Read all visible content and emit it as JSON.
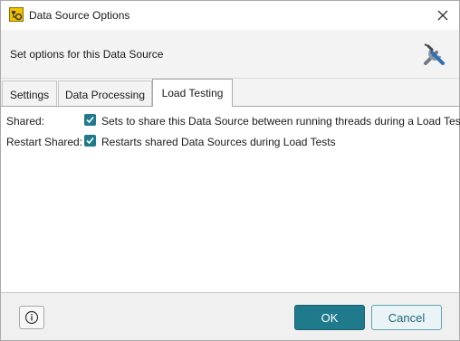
{
  "window": {
    "title": "Data Source Options",
    "app_icon": "data-source-icon",
    "close_icon": "close-icon"
  },
  "header": {
    "text": "Set options for this Data Source",
    "icon": "tools-icon"
  },
  "tabs": [
    {
      "label": "Settings",
      "active": false
    },
    {
      "label": "Data Processing",
      "active": false
    },
    {
      "label": "Load Testing",
      "active": true
    }
  ],
  "options": [
    {
      "label": "Shared:",
      "checked": true,
      "description": "Sets to share this Data Source between running threads during a Load Test"
    },
    {
      "label": "Restart Shared:",
      "checked": true,
      "description": "Restarts shared Data Sources during Load Tests"
    }
  ],
  "footer": {
    "info_icon": "info-icon",
    "ok_label": "OK",
    "cancel_label": "Cancel"
  },
  "colors": {
    "accent": "#1f7a8c",
    "cancel_bg": "#eaf4f6",
    "header_bg": "#f3f3f3"
  }
}
